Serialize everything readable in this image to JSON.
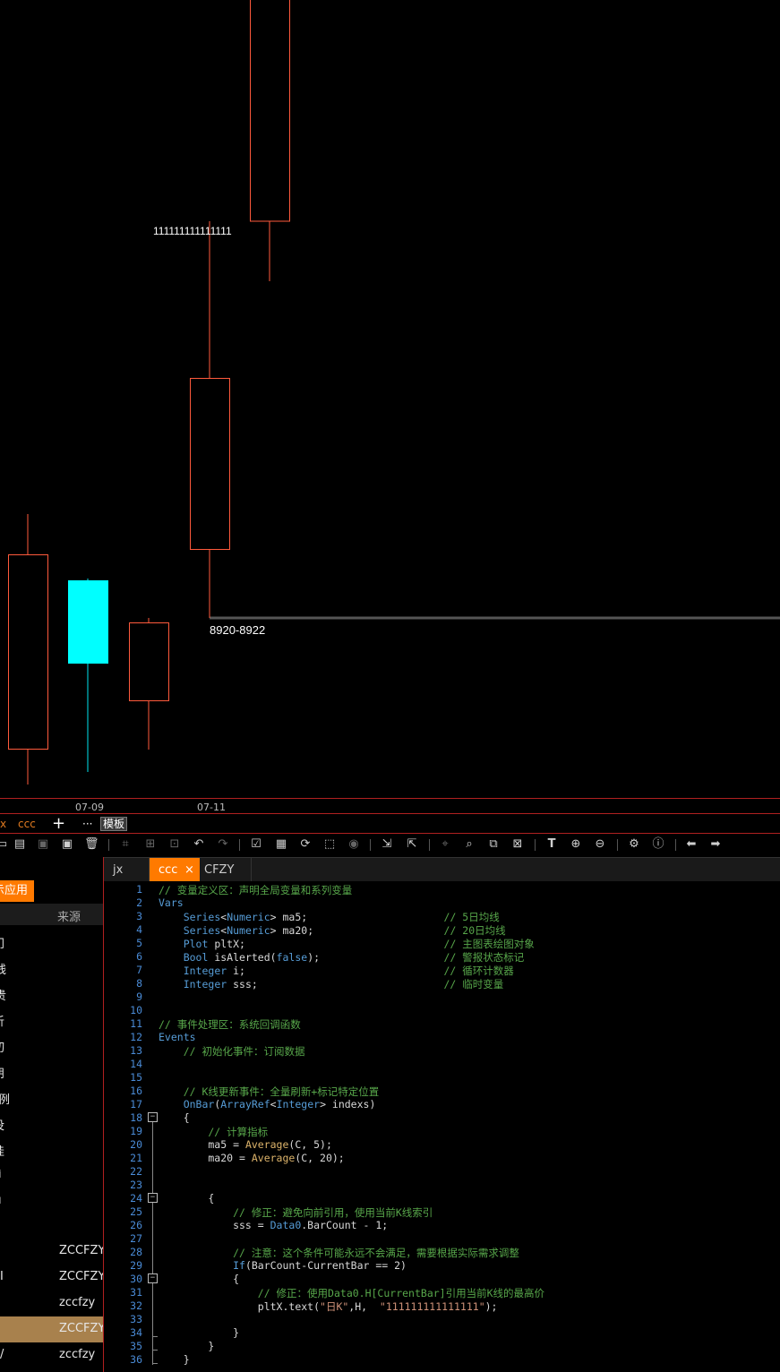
{
  "chart": {
    "annotation_label": "111111111111111",
    "price_label": "8920-8922",
    "x_labels": [
      "07-09",
      "07-11"
    ],
    "colors": {
      "up": "#ff5a3c",
      "down": "#00ffff",
      "price_line": "#555555",
      "border": "#b02020"
    }
  },
  "tabbar": {
    "items": [
      "x",
      "ccc",
      "+",
      "···"
    ],
    "template_label": "模板"
  },
  "toolbar": {
    "icons": [
      "new-folder-icon",
      "open-folder-icon",
      "save-icon",
      "save-all-icon",
      "delete-icon",
      "crop-icon",
      "add-icon",
      "import-icon",
      "undo-icon",
      "redo-icon",
      "check-icon",
      "compile-icon",
      "verify-icon",
      "select-icon",
      "stop-icon",
      "export-icon",
      "external-icon",
      "locate-icon",
      "search-icon",
      "replace-icon",
      "find-in-files-icon",
      "text-icon",
      "zoom-in-icon",
      "zoom-out-icon",
      "settings-icon",
      "info-icon",
      "back-icon",
      "forward-icon"
    ]
  },
  "sidebar": {
    "active_tab": "示应用",
    "source_header": "来源",
    "items": [
      "门",
      "线",
      "贵",
      "析",
      "切",
      "朋",
      "例",
      "没",
      "娃",
      "ì",
      "ı"
    ],
    "rows": [
      {
        "left": "",
        "source": "ZCCFZY"
      },
      {
        "left": "I",
        "source": "ZCCFZY"
      },
      {
        "left": "",
        "source": "zccfzy"
      },
      {
        "left": "",
        "source": "ZCCFZY"
      },
      {
        "left": "/",
        "source": "zccfzy"
      }
    ]
  },
  "editor": {
    "tabs": [
      {
        "label": "jx",
        "active": false
      },
      {
        "label": "ccc",
        "active": true,
        "close": "×"
      },
      {
        "label": "CFZY",
        "active": false
      }
    ],
    "lines": [
      {
        "n": "1",
        "code": "// 变量定义区：声明全局变量和系列变量",
        "type": "cm"
      },
      {
        "n": "2",
        "code": "Vars",
        "type": "kw"
      },
      {
        "n": "3",
        "code": "    Series<Numeric> ma5;                      // 5日均线",
        "type": "decl"
      },
      {
        "n": "4",
        "code": "    Series<Numeric> ma20;                     // 20日均线",
        "type": "decl"
      },
      {
        "n": "5",
        "code": "    Plot pltX;                                // 主图表绘图对象",
        "type": "decl"
      },
      {
        "n": "6",
        "code": "    Bool isAlerted(false);                    // 警报状态标记",
        "type": "decl"
      },
      {
        "n": "7",
        "code": "    Integer i;                                // 循环计数器",
        "type": "decl"
      },
      {
        "n": "8",
        "code": "    Integer sss;                              // 临时变量",
        "type": "decl"
      },
      {
        "n": "9",
        "code": "",
        "type": "plain"
      },
      {
        "n": "10",
        "code": "",
        "type": "plain"
      },
      {
        "n": "11",
        "code": "// 事件处理区：系统回调函数",
        "type": "cm"
      },
      {
        "n": "12",
        "code": "Events",
        "type": "kw"
      },
      {
        "n": "13",
        "code": "    // 初始化事件：订阅数据",
        "type": "cm"
      },
      {
        "n": "14",
        "code": "",
        "type": "plain"
      },
      {
        "n": "15",
        "code": "",
        "type": "plain"
      },
      {
        "n": "16",
        "code": "    // K线更新事件：全量刷新+标记特定位置",
        "type": "cm"
      },
      {
        "n": "17",
        "code": "    OnBar(ArrayRef<Integer> indexs)",
        "type": "kw"
      },
      {
        "n": "18",
        "code": "    {",
        "type": "plain"
      },
      {
        "n": "19",
        "code": "        // 计算指标",
        "type": "cm"
      },
      {
        "n": "20",
        "code": "        ma5 = Average(C, 5);",
        "type": "plain"
      },
      {
        "n": "21",
        "code": "        ma20 = Average(C, 20);",
        "type": "plain"
      },
      {
        "n": "22",
        "code": "",
        "type": "plain"
      },
      {
        "n": "23",
        "code": "",
        "type": "plain"
      },
      {
        "n": "24",
        "code": "        {",
        "type": "plain"
      },
      {
        "n": "25",
        "code": "            // 修正：避免向前引用，使用当前K线索引",
        "type": "cm"
      },
      {
        "n": "26",
        "code": "            sss = Data0.BarCount - 1;",
        "type": "plain"
      },
      {
        "n": "27",
        "code": "",
        "type": "plain"
      },
      {
        "n": "28",
        "code": "            // 注意：这个条件可能永远不会满足，需要根据实际需求调整",
        "type": "cm"
      },
      {
        "n": "29",
        "code": "            If(BarCount-CurrentBar == 2)",
        "type": "plain"
      },
      {
        "n": "30",
        "code": "            {",
        "type": "plain"
      },
      {
        "n": "31",
        "code": "                // 修正：使用Data0.H[CurrentBar]引用当前K线的最高价",
        "type": "cm"
      },
      {
        "n": "32",
        "code": "                pltX.text(\"日K\",H,  \"111111111111111\");",
        "type": "plain"
      },
      {
        "n": "33",
        "code": "",
        "type": "plain"
      },
      {
        "n": "34",
        "code": "            }",
        "type": "plain"
      },
      {
        "n": "35",
        "code": "        }",
        "type": "plain"
      },
      {
        "n": "36",
        "code": "    }",
        "type": "plain"
      }
    ]
  }
}
